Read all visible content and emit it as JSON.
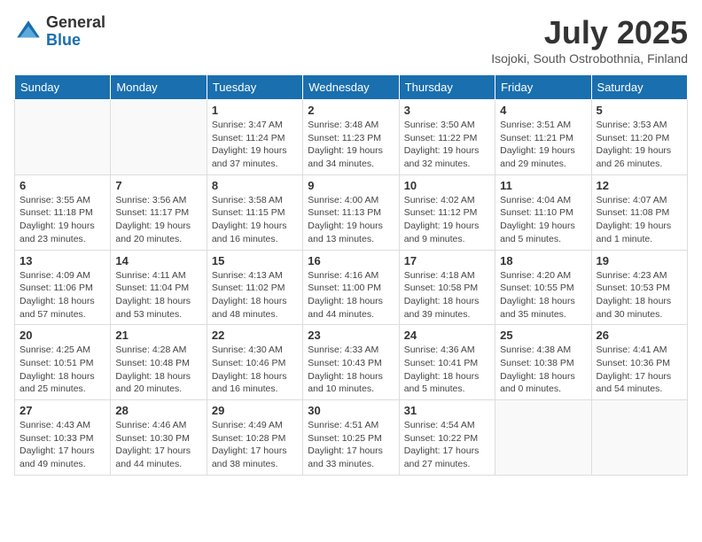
{
  "logo": {
    "general": "General",
    "blue": "Blue"
  },
  "title": "July 2025",
  "subtitle": "Isojoki, South Ostrobothnia, Finland",
  "weekdays": [
    "Sunday",
    "Monday",
    "Tuesday",
    "Wednesday",
    "Thursday",
    "Friday",
    "Saturday"
  ],
  "weeks": [
    [
      {
        "day": "",
        "info": ""
      },
      {
        "day": "",
        "info": ""
      },
      {
        "day": "1",
        "info": "Sunrise: 3:47 AM\nSunset: 11:24 PM\nDaylight: 19 hours and 37 minutes."
      },
      {
        "day": "2",
        "info": "Sunrise: 3:48 AM\nSunset: 11:23 PM\nDaylight: 19 hours and 34 minutes."
      },
      {
        "day": "3",
        "info": "Sunrise: 3:50 AM\nSunset: 11:22 PM\nDaylight: 19 hours and 32 minutes."
      },
      {
        "day": "4",
        "info": "Sunrise: 3:51 AM\nSunset: 11:21 PM\nDaylight: 19 hours and 29 minutes."
      },
      {
        "day": "5",
        "info": "Sunrise: 3:53 AM\nSunset: 11:20 PM\nDaylight: 19 hours and 26 minutes."
      }
    ],
    [
      {
        "day": "6",
        "info": "Sunrise: 3:55 AM\nSunset: 11:18 PM\nDaylight: 19 hours and 23 minutes."
      },
      {
        "day": "7",
        "info": "Sunrise: 3:56 AM\nSunset: 11:17 PM\nDaylight: 19 hours and 20 minutes."
      },
      {
        "day": "8",
        "info": "Sunrise: 3:58 AM\nSunset: 11:15 PM\nDaylight: 19 hours and 16 minutes."
      },
      {
        "day": "9",
        "info": "Sunrise: 4:00 AM\nSunset: 11:13 PM\nDaylight: 19 hours and 13 minutes."
      },
      {
        "day": "10",
        "info": "Sunrise: 4:02 AM\nSunset: 11:12 PM\nDaylight: 19 hours and 9 minutes."
      },
      {
        "day": "11",
        "info": "Sunrise: 4:04 AM\nSunset: 11:10 PM\nDaylight: 19 hours and 5 minutes."
      },
      {
        "day": "12",
        "info": "Sunrise: 4:07 AM\nSunset: 11:08 PM\nDaylight: 19 hours and 1 minute."
      }
    ],
    [
      {
        "day": "13",
        "info": "Sunrise: 4:09 AM\nSunset: 11:06 PM\nDaylight: 18 hours and 57 minutes."
      },
      {
        "day": "14",
        "info": "Sunrise: 4:11 AM\nSunset: 11:04 PM\nDaylight: 18 hours and 53 minutes."
      },
      {
        "day": "15",
        "info": "Sunrise: 4:13 AM\nSunset: 11:02 PM\nDaylight: 18 hours and 48 minutes."
      },
      {
        "day": "16",
        "info": "Sunrise: 4:16 AM\nSunset: 11:00 PM\nDaylight: 18 hours and 44 minutes."
      },
      {
        "day": "17",
        "info": "Sunrise: 4:18 AM\nSunset: 10:58 PM\nDaylight: 18 hours and 39 minutes."
      },
      {
        "day": "18",
        "info": "Sunrise: 4:20 AM\nSunset: 10:55 PM\nDaylight: 18 hours and 35 minutes."
      },
      {
        "day": "19",
        "info": "Sunrise: 4:23 AM\nSunset: 10:53 PM\nDaylight: 18 hours and 30 minutes."
      }
    ],
    [
      {
        "day": "20",
        "info": "Sunrise: 4:25 AM\nSunset: 10:51 PM\nDaylight: 18 hours and 25 minutes."
      },
      {
        "day": "21",
        "info": "Sunrise: 4:28 AM\nSunset: 10:48 PM\nDaylight: 18 hours and 20 minutes."
      },
      {
        "day": "22",
        "info": "Sunrise: 4:30 AM\nSunset: 10:46 PM\nDaylight: 18 hours and 16 minutes."
      },
      {
        "day": "23",
        "info": "Sunrise: 4:33 AM\nSunset: 10:43 PM\nDaylight: 18 hours and 10 minutes."
      },
      {
        "day": "24",
        "info": "Sunrise: 4:36 AM\nSunset: 10:41 PM\nDaylight: 18 hours and 5 minutes."
      },
      {
        "day": "25",
        "info": "Sunrise: 4:38 AM\nSunset: 10:38 PM\nDaylight: 18 hours and 0 minutes."
      },
      {
        "day": "26",
        "info": "Sunrise: 4:41 AM\nSunset: 10:36 PM\nDaylight: 17 hours and 54 minutes."
      }
    ],
    [
      {
        "day": "27",
        "info": "Sunrise: 4:43 AM\nSunset: 10:33 PM\nDaylight: 17 hours and 49 minutes."
      },
      {
        "day": "28",
        "info": "Sunrise: 4:46 AM\nSunset: 10:30 PM\nDaylight: 17 hours and 44 minutes."
      },
      {
        "day": "29",
        "info": "Sunrise: 4:49 AM\nSunset: 10:28 PM\nDaylight: 17 hours and 38 minutes."
      },
      {
        "day": "30",
        "info": "Sunrise: 4:51 AM\nSunset: 10:25 PM\nDaylight: 17 hours and 33 minutes."
      },
      {
        "day": "31",
        "info": "Sunrise: 4:54 AM\nSunset: 10:22 PM\nDaylight: 17 hours and 27 minutes."
      },
      {
        "day": "",
        "info": ""
      },
      {
        "day": "",
        "info": ""
      }
    ]
  ]
}
